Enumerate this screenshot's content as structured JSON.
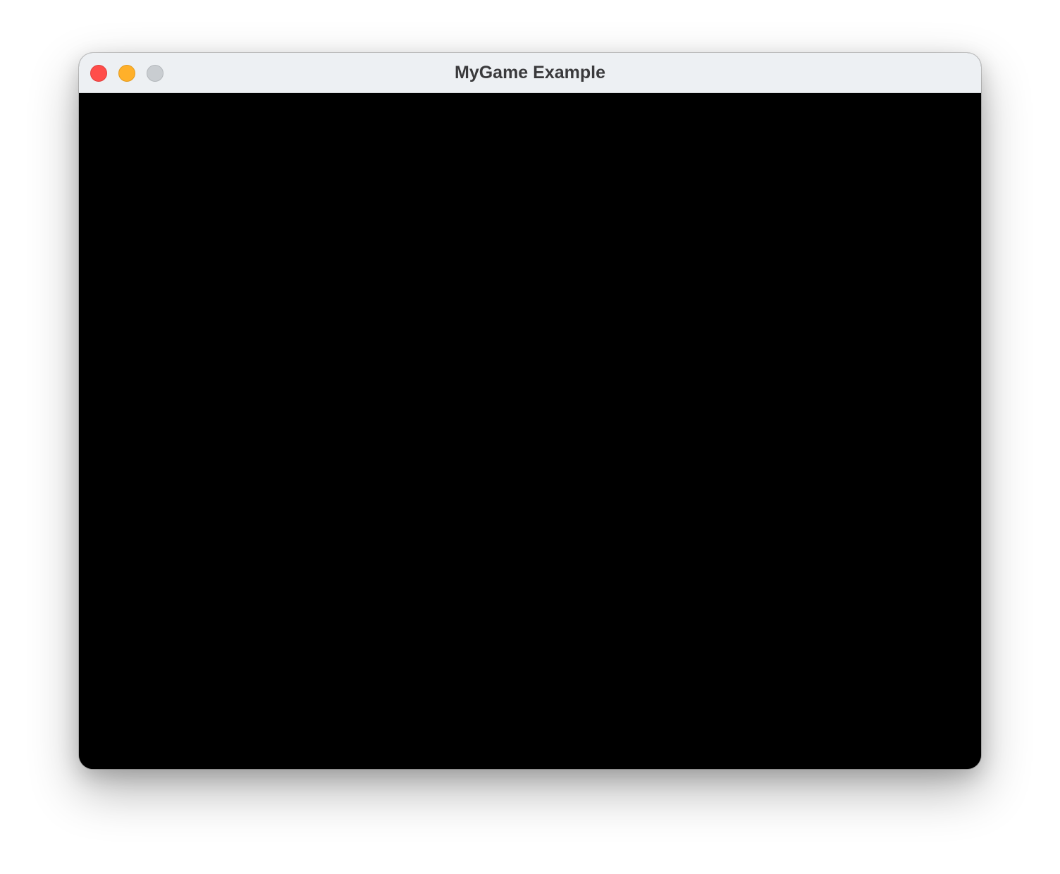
{
  "window": {
    "title": "MyGame Example",
    "controls": {
      "close": "close",
      "minimize": "minimize",
      "zoom": "zoom"
    },
    "canvas_color": "#000000"
  },
  "colors": {
    "close": "#ff4d4a",
    "minimize": "#ffb02a",
    "zoom_disabled": "#c9cdd1",
    "titlebar": "#edf0f3"
  }
}
